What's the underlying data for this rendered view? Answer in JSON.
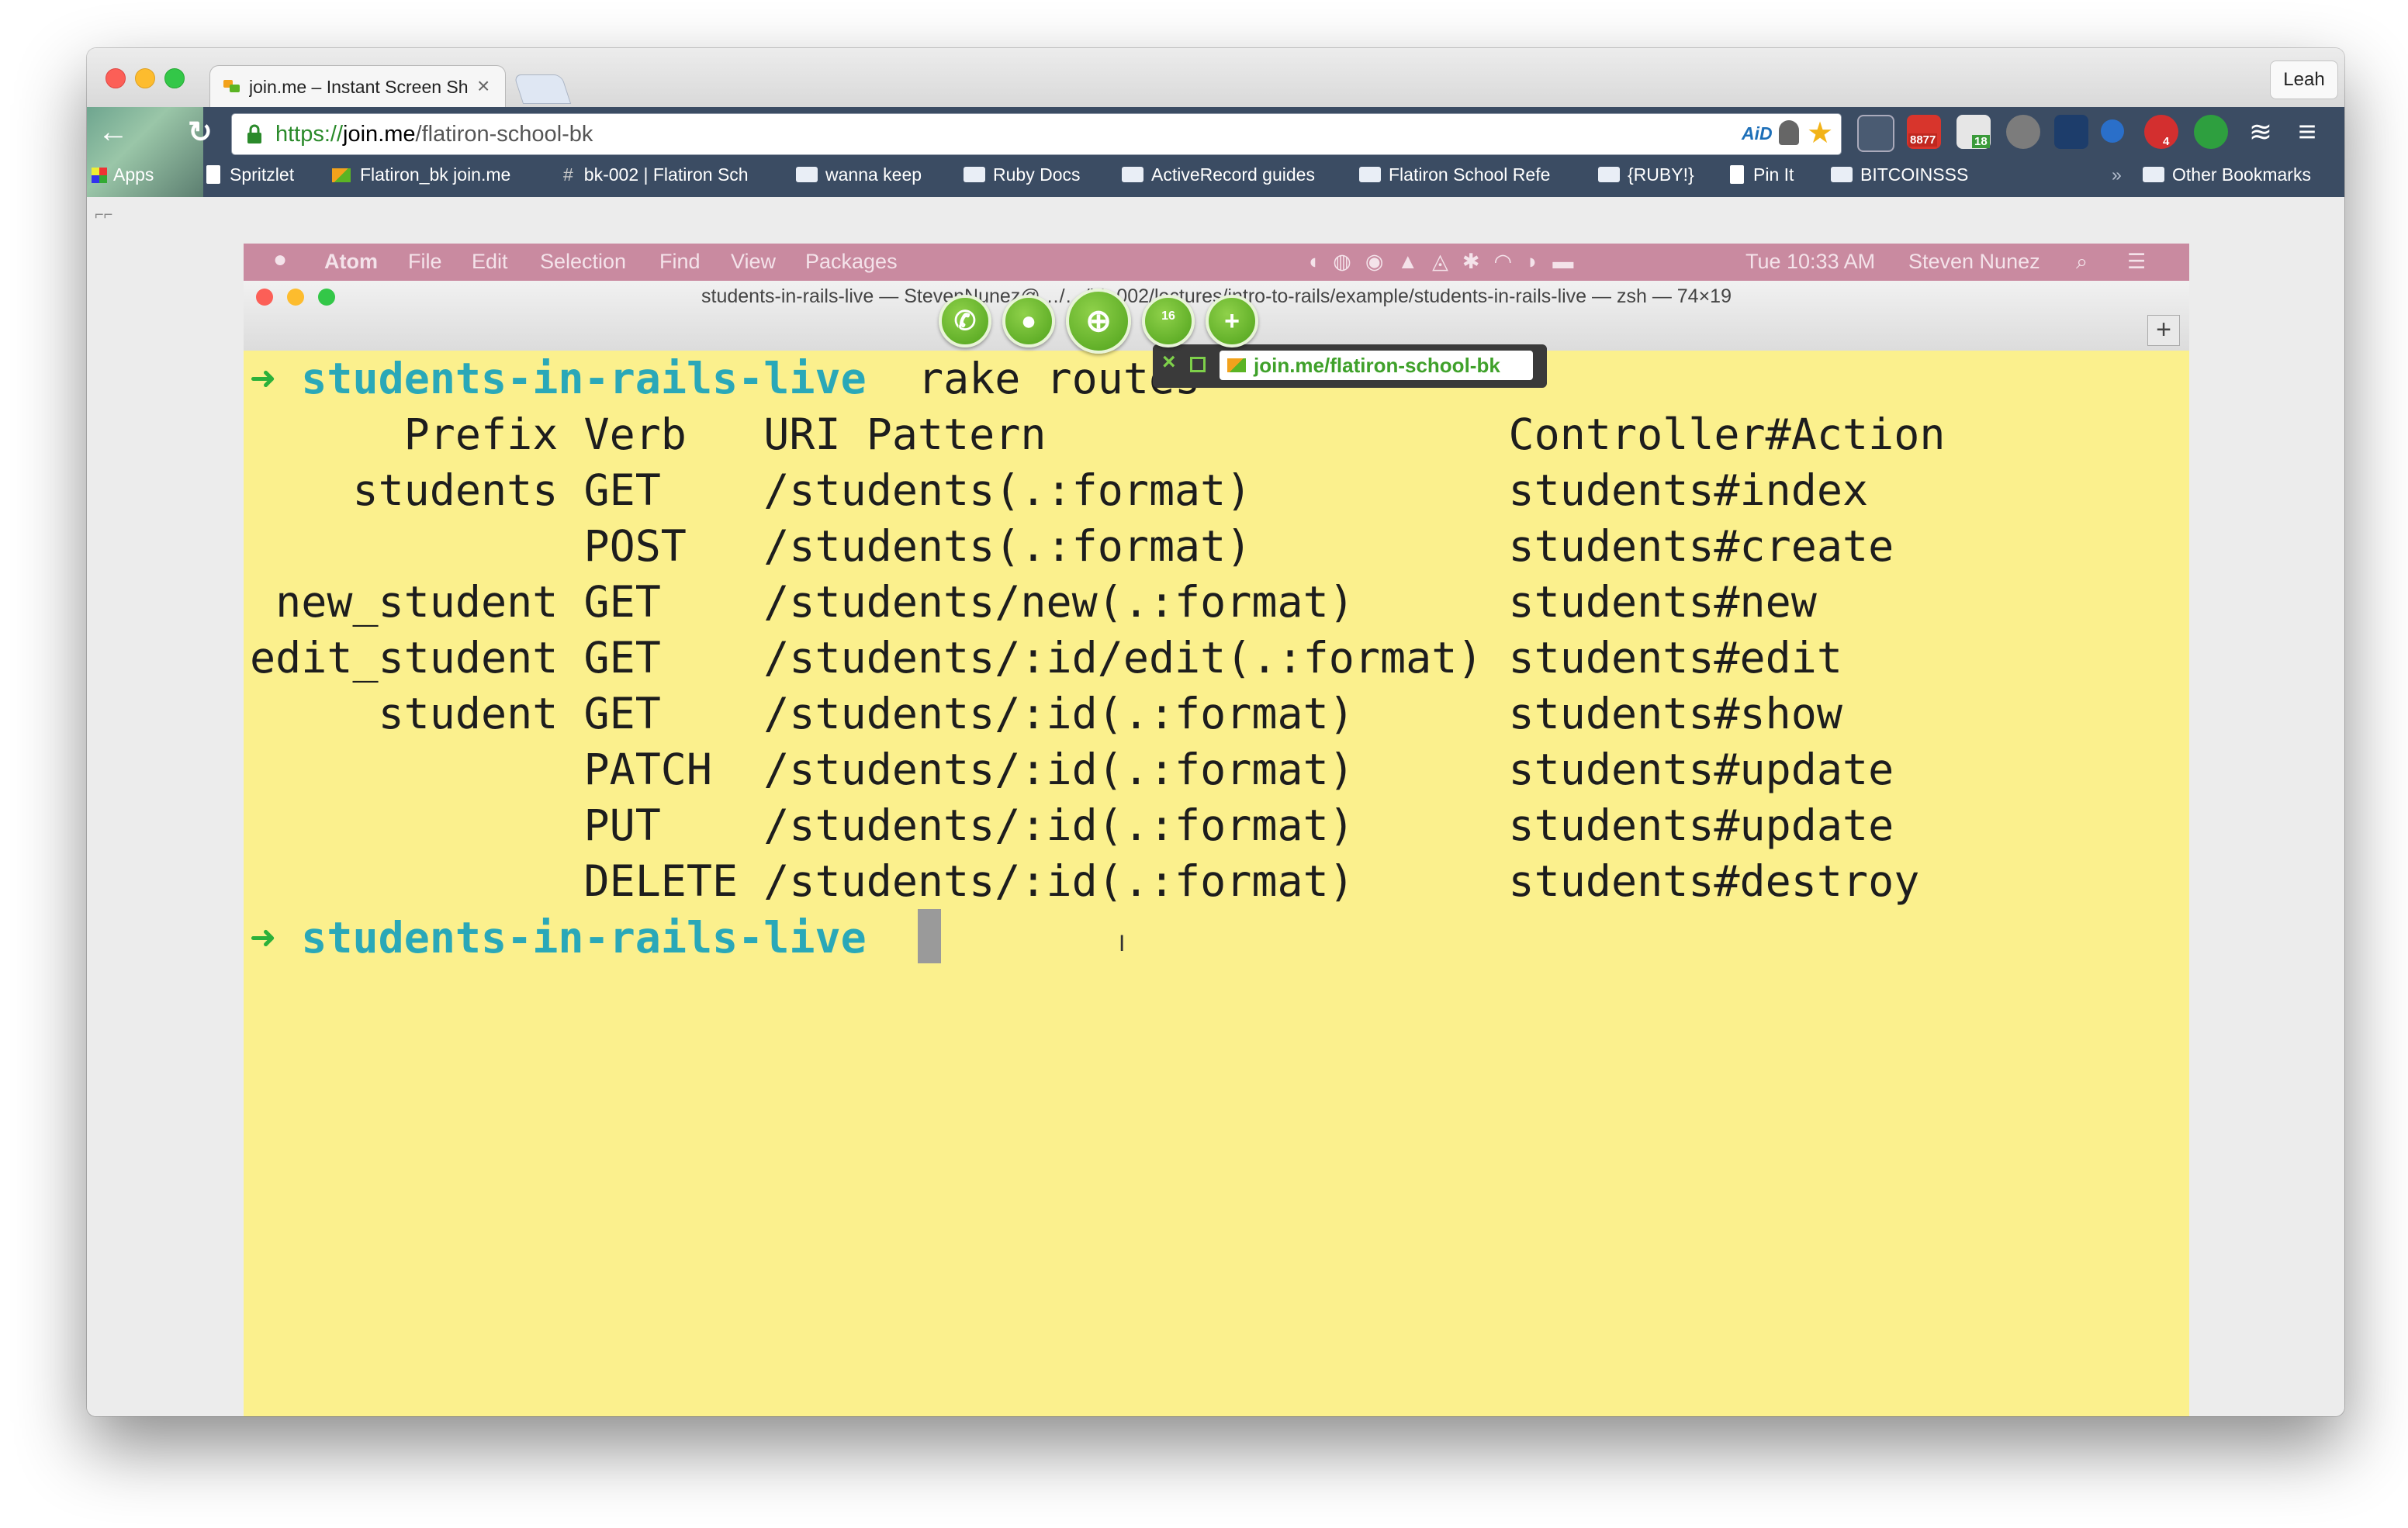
{
  "browser": {
    "tab": {
      "title": "join.me – Instant Screen Sh",
      "close": "×"
    },
    "profile_name": "Leah",
    "url": {
      "protocol": "https://",
      "host": "join.me",
      "path": "/flatiron-school-bk"
    },
    "extension_badges": {
      "gmail": "8877",
      "calendar": "18",
      "lastpass": "4"
    },
    "aid_label": "AiD",
    "bookmarks": [
      {
        "label": "Apps",
        "type": "apps"
      },
      {
        "label": "Spritzlet",
        "type": "page"
      },
      {
        "label": "Flatiron_bk join.me",
        "type": "joinme"
      },
      {
        "label": "bk-002 | Flatiron Sch",
        "type": "hash"
      },
      {
        "label": "wanna keep",
        "type": "folder"
      },
      {
        "label": "Ruby Docs",
        "type": "folder"
      },
      {
        "label": "ActiveRecord guides",
        "type": "folder"
      },
      {
        "label": "Flatiron School Refe",
        "type": "folder"
      },
      {
        "label": "{RUBY!}",
        "type": "folder"
      },
      {
        "label": "Pin It",
        "type": "page"
      },
      {
        "label": "BITCOINSSS",
        "type": "folder"
      }
    ],
    "bookmarks_overflow": "»",
    "other_bookmarks": "Other Bookmarks"
  },
  "remote_mac": {
    "menu": [
      "Atom",
      "File",
      "Edit",
      "Selection",
      "Find",
      "View",
      "Packages"
    ],
    "clock": "Tue 10:33 AM",
    "user": "Steven Nunez"
  },
  "terminal": {
    "title": "students-in-rails-live — StevenNunez@…/…/bk-002/lectures/intro-to-rails/example/students-in-rails-live — zsh — 74×19",
    "new_tab": "+",
    "prompt_arrow": "➜",
    "cwd": "students-in-rails-live",
    "command": "rake routes",
    "lines": [
      "      Prefix Verb   URI Pattern                  Controller#Action",
      "    students GET    /students(.:format)          students#index",
      "             POST   /students(.:format)          students#create",
      " new_student GET    /students/new(.:format)      students#new",
      "edit_student GET    /students/:id/edit(.:format) students#edit",
      "     student GET    /students/:id(.:format)      students#show",
      "             PATCH  /students/:id(.:format)      students#update",
      "             PUT    /students/:id(.:format)      students#update",
      "             DELETE /students/:id(.:format)      students#destroy"
    ]
  },
  "joinme": {
    "url": "join.me/flatiron-school-bk",
    "collapse": "×",
    "buttons": [
      "phone-icon",
      "chat-icon",
      "zoom-icon",
      "participants-icon",
      "add-icon"
    ],
    "participants_count": "16",
    "colors": {
      "green": "#5bb424",
      "bar": "#3a3a3a"
    }
  },
  "colors": {
    "terminal_bg": "#fbf08d",
    "prompt_cwd": "#2aa8b8",
    "prompt_arrow": "#2bb13a",
    "menubar": "#c98aa0"
  }
}
